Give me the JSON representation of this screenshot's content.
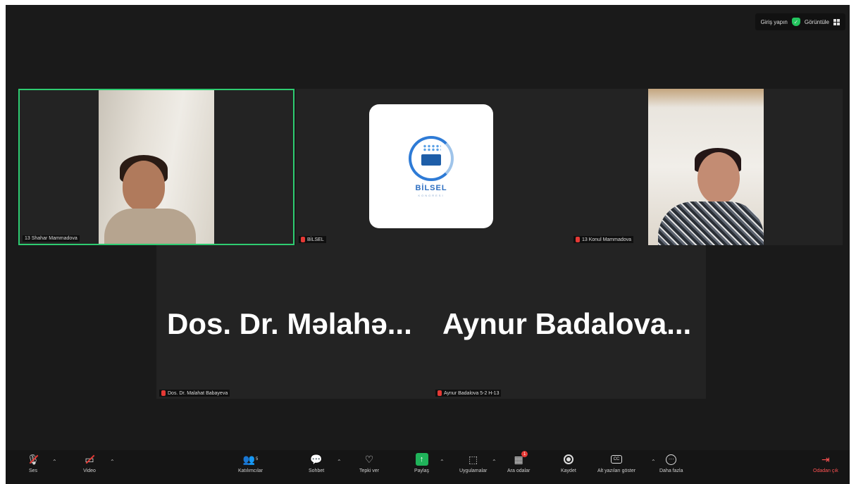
{
  "topbar": {
    "signin_label": "Giriş yapın",
    "view_label": "Görüntüle",
    "icons": [
      "shield-check-icon",
      "grid-view-icon"
    ]
  },
  "tiles": {
    "t1": {
      "name": "13 Shahar Mammadova"
    },
    "t2": {
      "name": "BİLSEL"
    },
    "t3": {
      "name": "13 Konul Mammadova"
    },
    "t4": {
      "name": "Dos. Dr. Malahat Babayeva",
      "display_name": "Dos. Dr. Məlahə..."
    },
    "t5": {
      "name": "Aynur Badalova 5-2 H-13",
      "display_name": "Aynur Badalova..."
    }
  },
  "logo": {
    "text": "BİLSEL",
    "subtext": "KONGRESİ"
  },
  "toolbar": {
    "audio": {
      "label": "Ses",
      "icon": "microphone-muted-icon"
    },
    "video": {
      "label": "Video",
      "icon": "camera-off-icon"
    },
    "participants": {
      "label": "Katılımcılar",
      "count": "5"
    },
    "chat": {
      "label": "Sohbet"
    },
    "react": {
      "label": "Tepki ver"
    },
    "share": {
      "label": "Paylaş"
    },
    "apps": {
      "label": "Uygulamalar"
    },
    "breakout": {
      "label": "Ara odalar",
      "badge": "1"
    },
    "record": {
      "label": "Kaydet"
    },
    "captions": {
      "label": "Alt yazıları göster"
    },
    "more": {
      "label": "Daha fazla"
    },
    "leave": {
      "label": "Odadan çık"
    }
  },
  "colors": {
    "active_speaker": "#2ecc71",
    "muted": "#e53935",
    "share": "#20b35a",
    "leave": "#ff5252"
  }
}
